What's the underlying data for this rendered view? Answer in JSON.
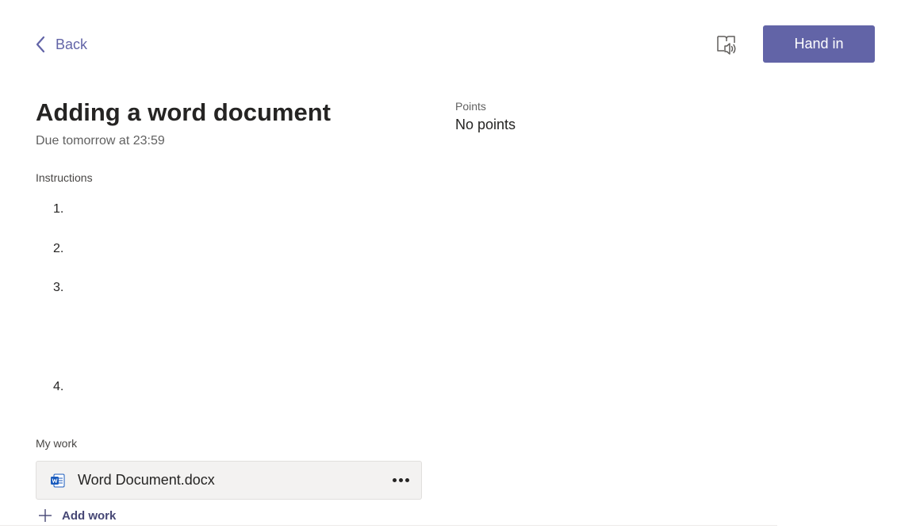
{
  "header": {
    "back_label": "Back",
    "hand_in_label": "Hand in",
    "reader_icon": "immersive-reader-icon"
  },
  "assignment": {
    "title": "Adding a word document",
    "due": "Due tomorrow at 23:59",
    "points_label": "Points",
    "points_value": "No points"
  },
  "instructions": {
    "label": "Instructions",
    "items": [
      "1.",
      "2.",
      "3.",
      "4."
    ]
  },
  "my_work": {
    "label": "My work",
    "file_name": "Word Document.docx",
    "file_icon": "word-file-icon",
    "add_work_label": "Add work"
  },
  "colors": {
    "accent": "#6264a7",
    "accent_dark": "#464775",
    "word_blue": "#185abd"
  }
}
